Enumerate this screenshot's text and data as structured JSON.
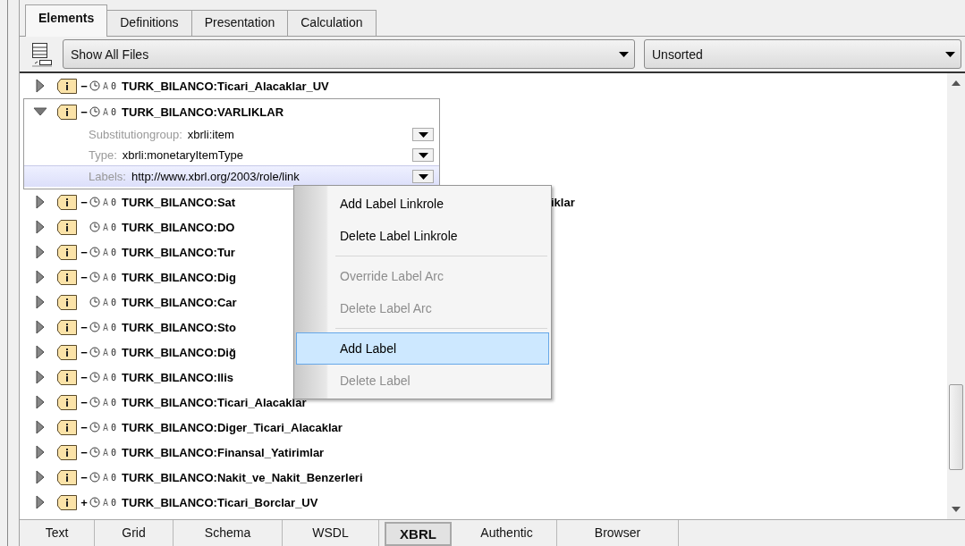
{
  "top_tabs": [
    {
      "label": "Elements",
      "selected": true
    },
    {
      "label": "Definitions",
      "selected": false
    },
    {
      "label": "Presentation",
      "selected": false
    },
    {
      "label": "Calculation",
      "selected": false
    }
  ],
  "toolbar": {
    "file_filter": "Show All Files",
    "sort_order": "Unsorted"
  },
  "tree": {
    "rows": [
      {
        "name": "TURK_BILANCO:Ticari_Alacaklar_UV",
        "sign": "−",
        "marks": [
          "A",
          "0"
        ],
        "expanded": false
      },
      {
        "name": "TURK_BILANCO:VARLIKLAR",
        "sign": "−",
        "marks": [
          "A",
          "0"
        ],
        "expanded": true,
        "properties": [
          {
            "label": "Substitutiongroup:",
            "value": "xbrli:item",
            "selected": false
          },
          {
            "label": "Type:",
            "value": "xbrli:monetaryItemType",
            "selected": false
          },
          {
            "label": "Labels:",
            "value": "http://www.xbrl.org/2003/role/link",
            "selected": true
          }
        ]
      },
      {
        "name": "TURK_BILANCO:Sat",
        "tail": "iklar",
        "sign": "−",
        "marks": [
          "A",
          "0"
        ],
        "expanded": false
      },
      {
        "name": "TURK_BILANCO:DO",
        "marks": [
          "A",
          "0"
        ],
        "expanded": false
      },
      {
        "name": "TURK_BILANCO:Tur",
        "sign": "−",
        "marks": [
          "A",
          "0"
        ],
        "expanded": false
      },
      {
        "name": "TURK_BILANCO:Dig",
        "sign": "−",
        "marks": [
          "A",
          "0"
        ],
        "expanded": false
      },
      {
        "name": "TURK_BILANCO:Car",
        "marks": [
          "A",
          "0"
        ],
        "expanded": false
      },
      {
        "name": "TURK_BILANCO:Sto",
        "sign": "−",
        "marks": [
          "A",
          "0"
        ],
        "expanded": false
      },
      {
        "name": "TURK_BILANCO:Diğ",
        "sign": "−",
        "marks": [
          "A",
          "0"
        ],
        "expanded": false
      },
      {
        "name": "TURK_BILANCO:Ilis",
        "sign": "−",
        "marks": [
          "A",
          "0"
        ],
        "expanded": false
      },
      {
        "name": "TURK_BILANCO:Ticari_Alacaklar",
        "sign": "−",
        "marks": [
          "A",
          "0"
        ],
        "expanded": false
      },
      {
        "name": "TURK_BILANCO:Diger_Ticari_Alacaklar",
        "sign": "−",
        "marks": [
          "A",
          "0"
        ],
        "expanded": false
      },
      {
        "name": "TURK_BILANCO:Finansal_Yatirimlar",
        "sign": "−",
        "marks": [
          "A",
          "0"
        ],
        "expanded": false
      },
      {
        "name": "TURK_BILANCO:Nakit_ve_Nakit_Benzerleri",
        "sign": "−",
        "marks": [
          "A",
          "0"
        ],
        "expanded": false
      },
      {
        "name": "TURK_BILANCO:Ticari_Borclar_UV",
        "sign": "+",
        "marks": [
          "A",
          "0"
        ],
        "expanded": false
      }
    ]
  },
  "context_menu": {
    "groups": [
      [
        {
          "label": "Add Label Linkrole",
          "disabled": false,
          "selected": false
        },
        {
          "label": "Delete Label Linkrole",
          "disabled": false,
          "selected": false
        }
      ],
      [
        {
          "label": "Override Label Arc",
          "disabled": true,
          "selected": false
        },
        {
          "label": "Delete Label Arc",
          "disabled": true,
          "selected": false
        }
      ],
      [
        {
          "label": "Add Label",
          "disabled": false,
          "selected": true
        },
        {
          "label": "Delete Label",
          "disabled": true,
          "selected": false
        }
      ]
    ]
  },
  "bottom_tabs": [
    {
      "label": "Text",
      "selected": false
    },
    {
      "label": "Grid",
      "selected": false
    },
    {
      "label": "Schema",
      "selected": false
    },
    {
      "label": "WSDL",
      "selected": false
    },
    {
      "label": "XBRL",
      "selected": true
    },
    {
      "label": "Authentic",
      "selected": false
    },
    {
      "label": "Browser",
      "selected": false
    }
  ]
}
